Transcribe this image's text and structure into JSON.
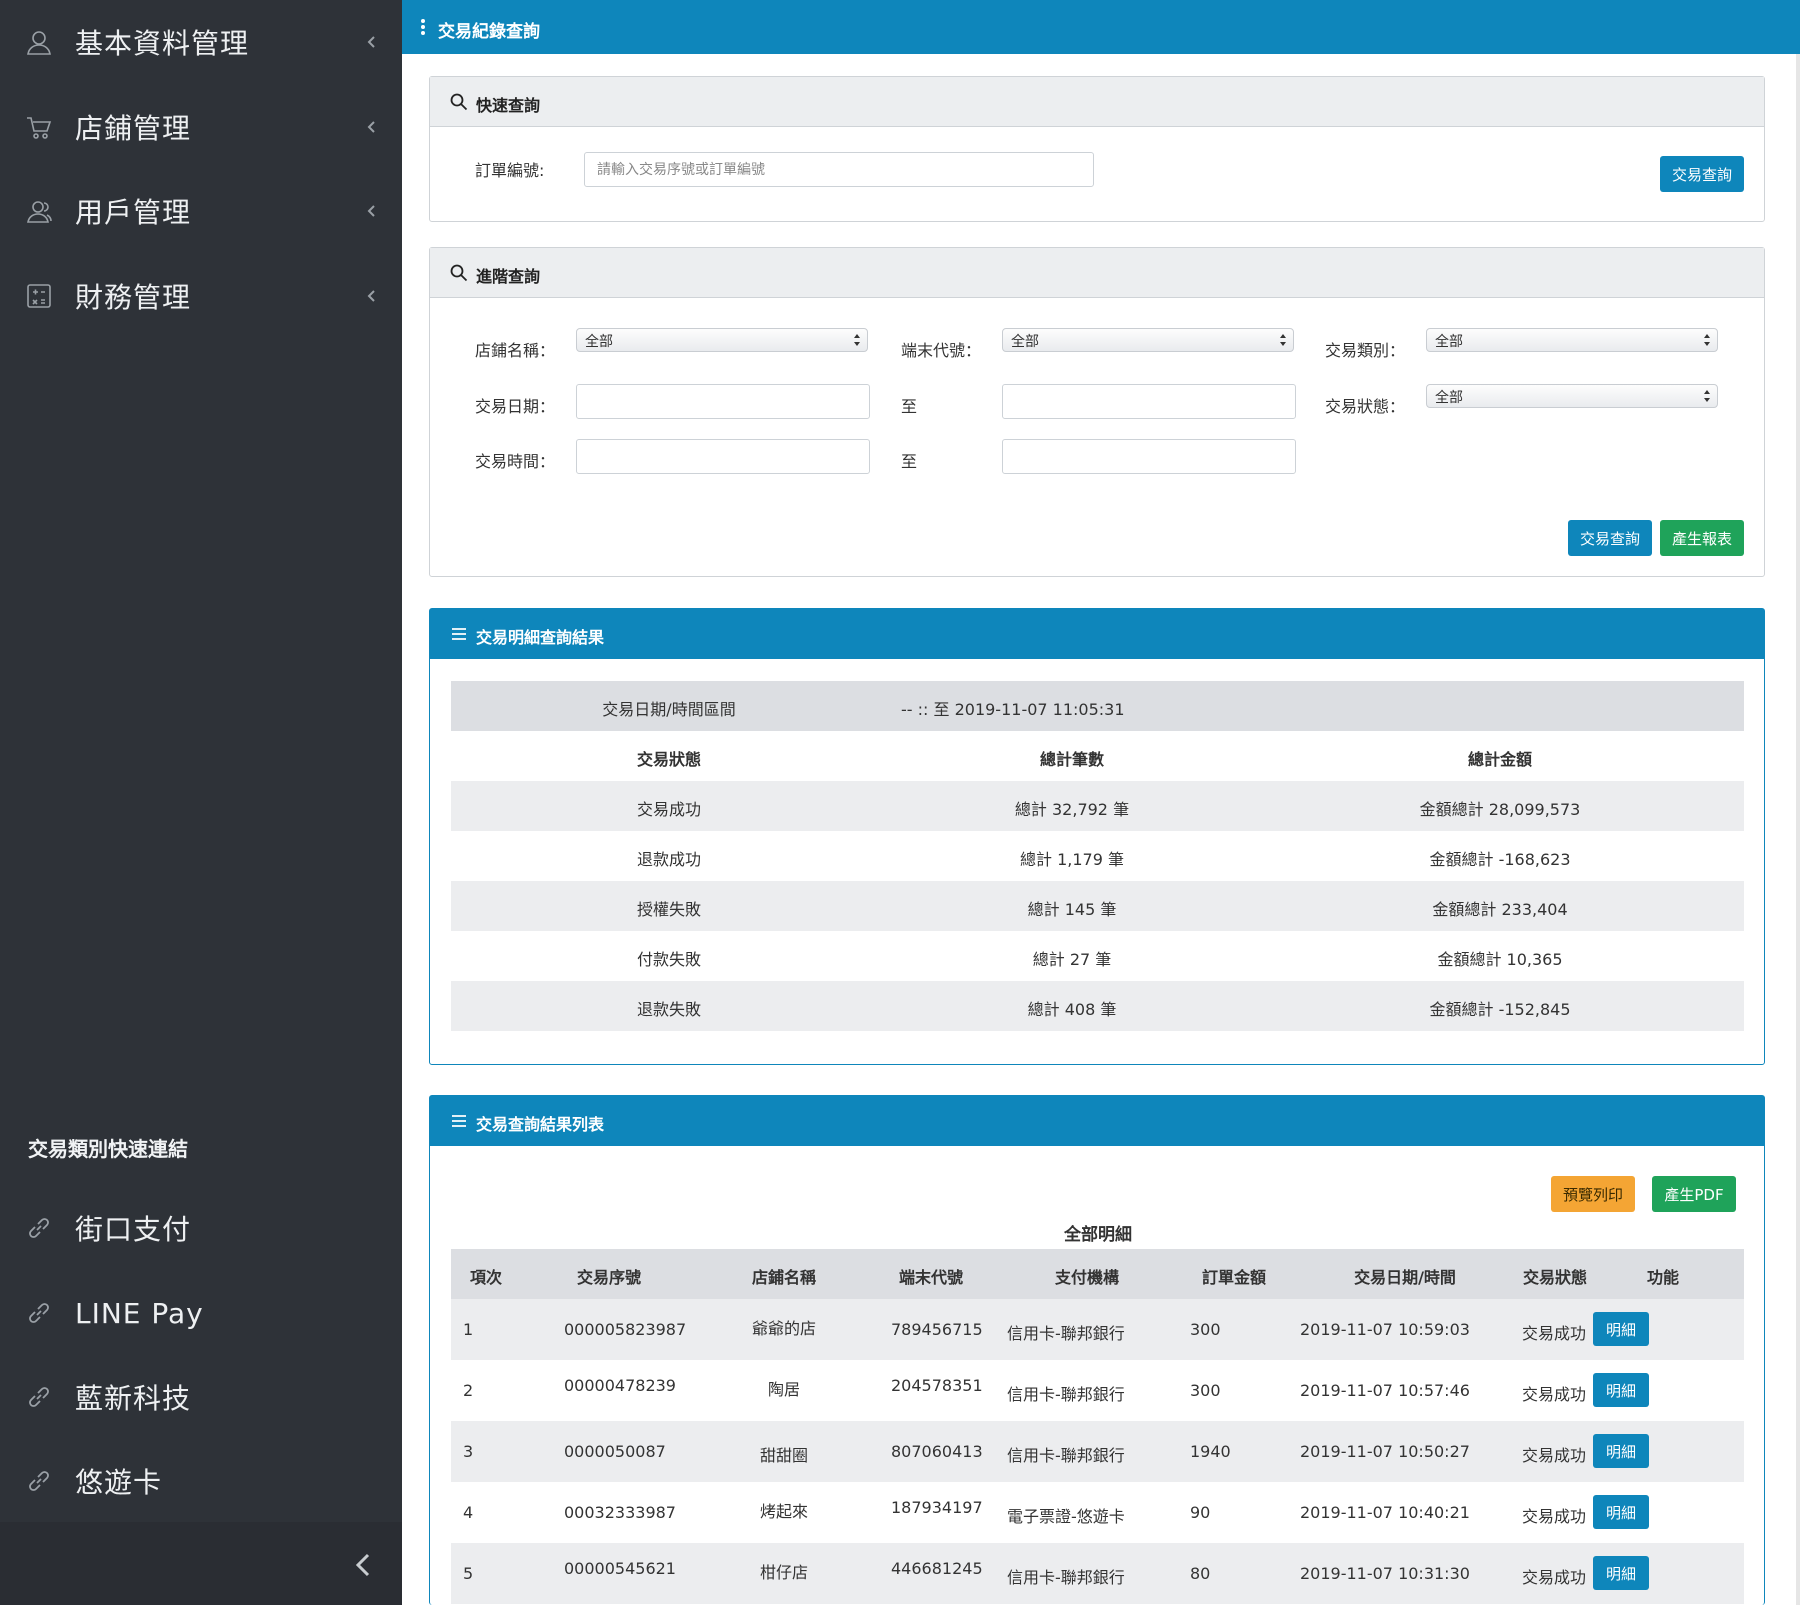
{
  "sidebar": {
    "items": [
      {
        "label": "基本資料管理",
        "icon": "user-icon"
      },
      {
        "label": "店鋪管理",
        "icon": "cart-icon"
      },
      {
        "label": "用戶管理",
        "icon": "users-icon"
      },
      {
        "label": "財務管理",
        "icon": "calculator-icon"
      }
    ],
    "quick_links_heading": "交易類別快速連結",
    "quick_links": [
      {
        "label": "街口支付",
        "icon": "link-icon"
      },
      {
        "label": "LINE Pay",
        "icon": "link-icon"
      },
      {
        "label": "藍新科技",
        "icon": "link-icon"
      },
      {
        "label": "悠遊卡",
        "icon": "link-icon"
      }
    ]
  },
  "topbar": {
    "title": "交易紀錄查詢"
  },
  "quick_search": {
    "title": "快速查詢",
    "order_label": "訂單編號:",
    "order_placeholder": "請輸入交易序號或訂單編號",
    "order_value": "",
    "search_button": "交易查詢"
  },
  "advanced_search": {
    "title": "進階查詢",
    "shop_label": "店鋪名稱：",
    "shop_value": "全部",
    "terminal_label": "端末代號：",
    "terminal_value": "全部",
    "type_label": "交易類別：",
    "type_value": "全部",
    "date_label": "交易日期：",
    "date_to": "至",
    "status_label": "交易狀態：",
    "status_value": "全部",
    "time_label": "交易時間：",
    "time_to": "至",
    "search_button": "交易查詢",
    "report_button": "產生報表"
  },
  "summary": {
    "title": "交易明細查詢結果",
    "range_label": "交易日期/時間區間",
    "range_value": "-- :: 至 2019-11-07 11:05:31",
    "headers": [
      "交易狀態",
      "總計筆數",
      "總計金額"
    ],
    "rows": [
      {
        "status": "交易成功",
        "count": "總計 32,792 筆",
        "amount": "金額總計 28,099,573"
      },
      {
        "status": "退款成功",
        "count": "總計 1,179 筆",
        "amount": "金額總計 -168,623"
      },
      {
        "status": "授權失敗",
        "count": "總計 145 筆",
        "amount": "金額總計 233,404"
      },
      {
        "status": "付款失敗",
        "count": "總計 27 筆",
        "amount": "金額總計 10,365"
      },
      {
        "status": "退款失敗",
        "count": "總計 408 筆",
        "amount": "金額總計 -152,845"
      }
    ]
  },
  "results": {
    "title": "交易查詢結果列表",
    "print_button": "預覽列印",
    "pdf_button": "產生PDF",
    "caption": "全部明細",
    "headers": [
      "項次",
      "交易序號",
      "店鋪名稱",
      "端末代號",
      "支付機構",
      "訂單金額",
      "交易日期/時間",
      "交易狀態",
      "功能"
    ],
    "rows": [
      {
        "no": "1",
        "serial": "000005823987",
        "shop": "爺爺的店",
        "terminal": "789456715",
        "payment": "信用卡-聯邦銀行",
        "amount": "300",
        "datetime": "2019-11-07 10:59:03",
        "status": "交易成功",
        "action": "明細"
      },
      {
        "no": "2",
        "serial": "00000478239",
        "shop": "陶居",
        "terminal": "204578351",
        "payment": "信用卡-聯邦銀行",
        "amount": "300",
        "datetime": "2019-11-07 10:57:46",
        "status": "交易成功",
        "action": "明細"
      },
      {
        "no": "3",
        "serial": "0000050087",
        "shop": "甜甜圈",
        "terminal": "807060413",
        "payment": "信用卡-聯邦銀行",
        "amount": "1940",
        "datetime": "2019-11-07 10:50:27",
        "status": "交易成功",
        "action": "明細"
      },
      {
        "no": "4",
        "serial": "00032333987",
        "shop": "烤起來",
        "terminal": "187934197",
        "payment": "電子票證-悠遊卡",
        "amount": "90",
        "datetime": "2019-11-07 10:40:21",
        "status": "交易成功",
        "action": "明細"
      },
      {
        "no": "5",
        "serial": "00000545621",
        "shop": "柑仔店",
        "terminal": "446681245",
        "payment": "信用卡-聯邦銀行",
        "amount": "80",
        "datetime": "2019-11-07 10:31:30",
        "status": "交易成功",
        "action": "明細"
      }
    ]
  },
  "colors": {
    "sidebar_bg": "#2e3238",
    "accent": "#0e86bb",
    "green": "#1fa35a",
    "orange": "#f4a534"
  }
}
